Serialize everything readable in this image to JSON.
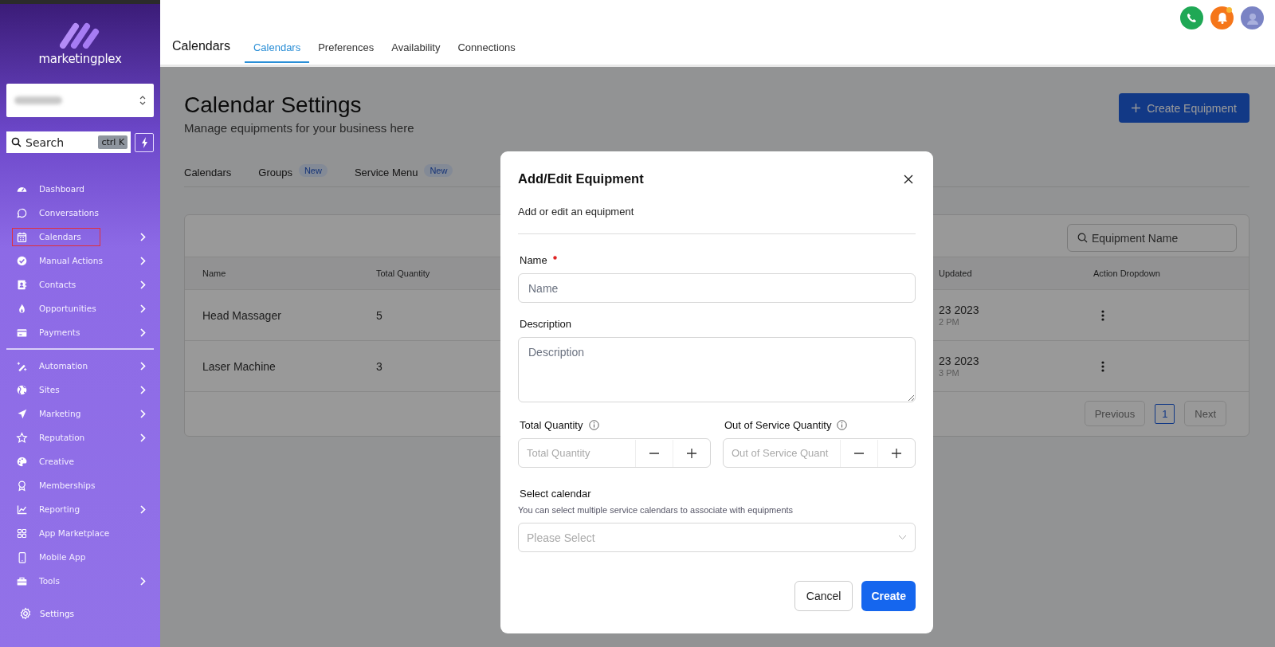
{
  "sidebar": {
    "logo_text": "marketingplex",
    "search": {
      "placeholder": "Search",
      "shortcut": "ctrl K"
    },
    "items": [
      {
        "label": "Dashboard",
        "selected": false,
        "expandable": false
      },
      {
        "label": "Conversations",
        "selected": false,
        "expandable": false
      },
      {
        "label": "Calendars",
        "selected": true,
        "expandable": true
      },
      {
        "label": "Manual Actions",
        "selected": false,
        "expandable": true
      },
      {
        "label": "Contacts",
        "selected": false,
        "expandable": true
      },
      {
        "label": "Opportunities",
        "selected": false,
        "expandable": true
      },
      {
        "label": "Payments",
        "selected": false,
        "expandable": true
      },
      {
        "label": "Automation",
        "selected": false,
        "expandable": true
      },
      {
        "label": "Sites",
        "selected": false,
        "expandable": true
      },
      {
        "label": "Marketing",
        "selected": false,
        "expandable": true
      },
      {
        "label": "Reputation",
        "selected": false,
        "expandable": true
      },
      {
        "label": "Creative",
        "selected": false,
        "expandable": false
      },
      {
        "label": "Memberships",
        "selected": false,
        "expandable": false
      },
      {
        "label": "Reporting",
        "selected": false,
        "expandable": true
      },
      {
        "label": "App Marketplace",
        "selected": false,
        "expandable": false
      },
      {
        "label": "Mobile App",
        "selected": false,
        "expandable": false
      },
      {
        "label": "Tools",
        "selected": false,
        "expandable": true
      }
    ],
    "settings": {
      "label": "Settings"
    }
  },
  "header": {
    "title": "Calendars",
    "tabs": [
      {
        "label": "Calendars",
        "selected": true
      },
      {
        "label": "Preferences",
        "selected": false
      },
      {
        "label": "Availability",
        "selected": false
      },
      {
        "label": "Connections",
        "selected": false
      }
    ]
  },
  "page": {
    "title": "Calendar Settings",
    "subtitle": "Manage equipments for your business here",
    "create_button": "Create Equipment",
    "tabs": [
      {
        "label": "Calendars"
      },
      {
        "label": "Groups",
        "badge": "New"
      },
      {
        "label": "Service Menu",
        "badge": "New"
      }
    ]
  },
  "table": {
    "search_placeholder": "Equipment Name",
    "columns": [
      "Name",
      "Total Quantity",
      "Updated",
      "Action Dropdown"
    ],
    "rows": [
      {
        "name": "Head Massager",
        "total_quantity": "5",
        "updated_date": "23 2023",
        "updated_time": "2 PM"
      },
      {
        "name": "Laser Machine",
        "total_quantity": "3",
        "updated_date": "23 2023",
        "updated_time": "3 PM"
      }
    ],
    "pagination": {
      "previous": "Previous",
      "pages": [
        {
          "label": "1",
          "selected": true
        }
      ],
      "next": "Next"
    }
  },
  "modal": {
    "title": "Add/Edit Equipment",
    "subtitle": "Add or edit an equipment",
    "name": {
      "label": "Name",
      "placeholder": "Name",
      "required": true
    },
    "description": {
      "label": "Description",
      "placeholder": "Description"
    },
    "quantities": [
      {
        "label": "Total Quantity",
        "placeholder": "Total Quantity"
      },
      {
        "label": "Out of Service Quantity",
        "placeholder": "Out of Service Quant"
      }
    ],
    "calendar": {
      "label": "Select calendar",
      "hint": "You can select multiple service calendars to associate with equipments",
      "placeholder": "Please Select"
    },
    "cancel": "Cancel",
    "create": "Create"
  }
}
